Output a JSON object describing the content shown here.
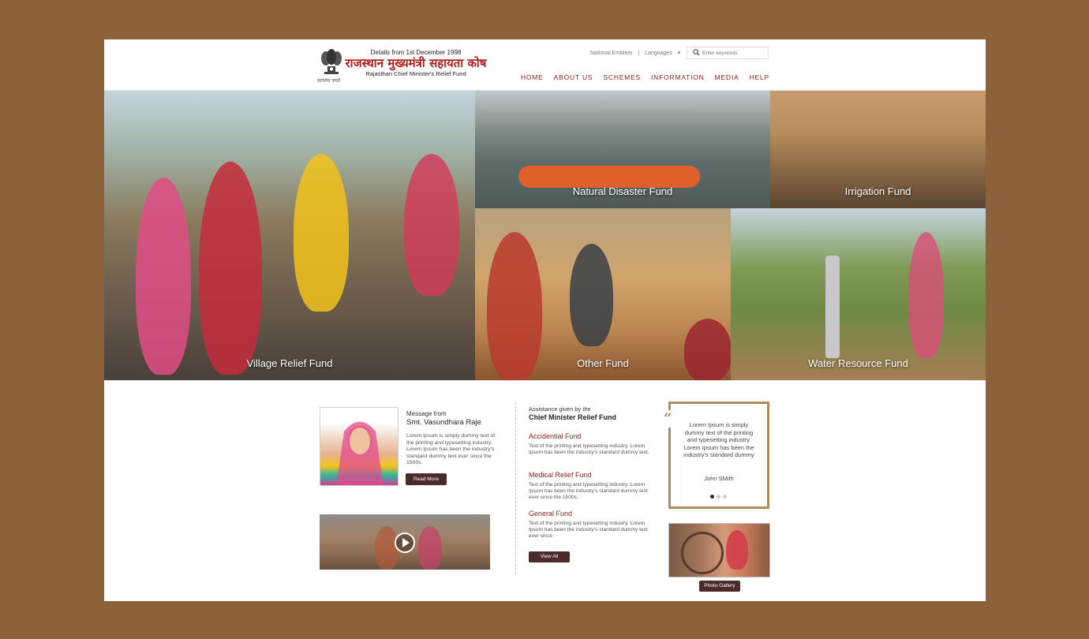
{
  "header": {
    "since": "Details from 1st December 1998",
    "title_hindi": "राजस्थान मुख्यमंत्री सहायता कोष",
    "title_english": "Rajasthan Chief Minister's Relief Fund",
    "emblem_motto": "सत्यमेव जयते",
    "toplinks": [
      "National Emblem",
      "|",
      "Languages"
    ],
    "search_placeholder": "Enter keywords",
    "nav": [
      "HOME",
      "ABOUT US",
      "SCHEMES",
      "INFORMATION",
      "MEDIA",
      "HELP"
    ]
  },
  "tiles": {
    "village": "Village Relief Fund",
    "natural": "Natural Disaster Fund",
    "irrigation": "Irrigation Fund",
    "other": "Other Fund",
    "water": "Water Resource Fund"
  },
  "message": {
    "from": "Message from",
    "name": "Smt. Vasundhara Raje",
    "text": "Lorem Ipsum is simply dummy text of the printing and typesetting industry. Lorem Ipsum has been the industry's standard dummy text ever since the 1500s.",
    "button": "Read More"
  },
  "assistance": {
    "intro": "Assistance given by the",
    "title": "Chief Minister Relief Fund",
    "funds": [
      {
        "title": "Accidential Fund",
        "text": "Text of the printing and typesetting industry. Lorem Ipsum has been the industry's standard dummy text."
      },
      {
        "title": "Medical Relief Fund",
        "text": "Text of the printing and typesetting industry. Lorem Ipsum has been the industry's standard dummy text ever since the 1500s."
      },
      {
        "title": "General Fund",
        "text": "Text of the printing and typesetting industry. Lorem Ipsum has been the industry's standard dummy text ever since"
      }
    ],
    "button": "View All"
  },
  "testimonial": {
    "quote_mark": "“",
    "text": "Lorem Ipsum is simply dummy text of the printing and typesetting industry. Lorem Ipsum has been the industry's standard dummy",
    "author": "John SMith",
    "slide_count": 3,
    "active_slide": 1
  },
  "gallery": {
    "button": "Photo Gallery"
  },
  "colors": {
    "background": "#8d6139",
    "accent": "#8a2121",
    "button": "#4d2a2a",
    "frame": "#b08b5e"
  },
  "icons": {
    "search": "search-icon",
    "dropdown": "caret-down-icon",
    "play": "play-icon",
    "emblem": "state-emblem-icon"
  }
}
